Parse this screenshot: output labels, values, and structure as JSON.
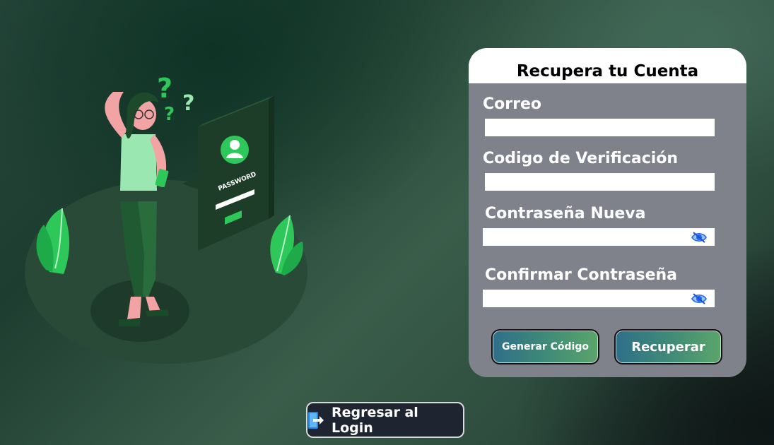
{
  "card": {
    "title": "Recupera tu Cuenta",
    "email_label": "Correo",
    "email_value": "",
    "code_label": "Codigo de Verificación",
    "code_value": "",
    "new_password_label": "Contraseña Nueva",
    "new_password_value": "",
    "confirm_password_label": "Confirmar Contraseña",
    "confirm_password_value": "",
    "generate_code_button": "Generar Código",
    "recover_button": "Recuperar"
  },
  "back_button": {
    "label": "Regresar al Login",
    "icon": "exit-arrow-icon"
  },
  "illustration": {
    "screen_text": "PASSWORD"
  },
  "colors": {
    "card_bg": "#7f828b",
    "accent_green": "#22c55e",
    "button_gradient_start": "#2f6f8a",
    "button_gradient_end": "#5aa56a",
    "eye_icon": "#2563eb"
  }
}
